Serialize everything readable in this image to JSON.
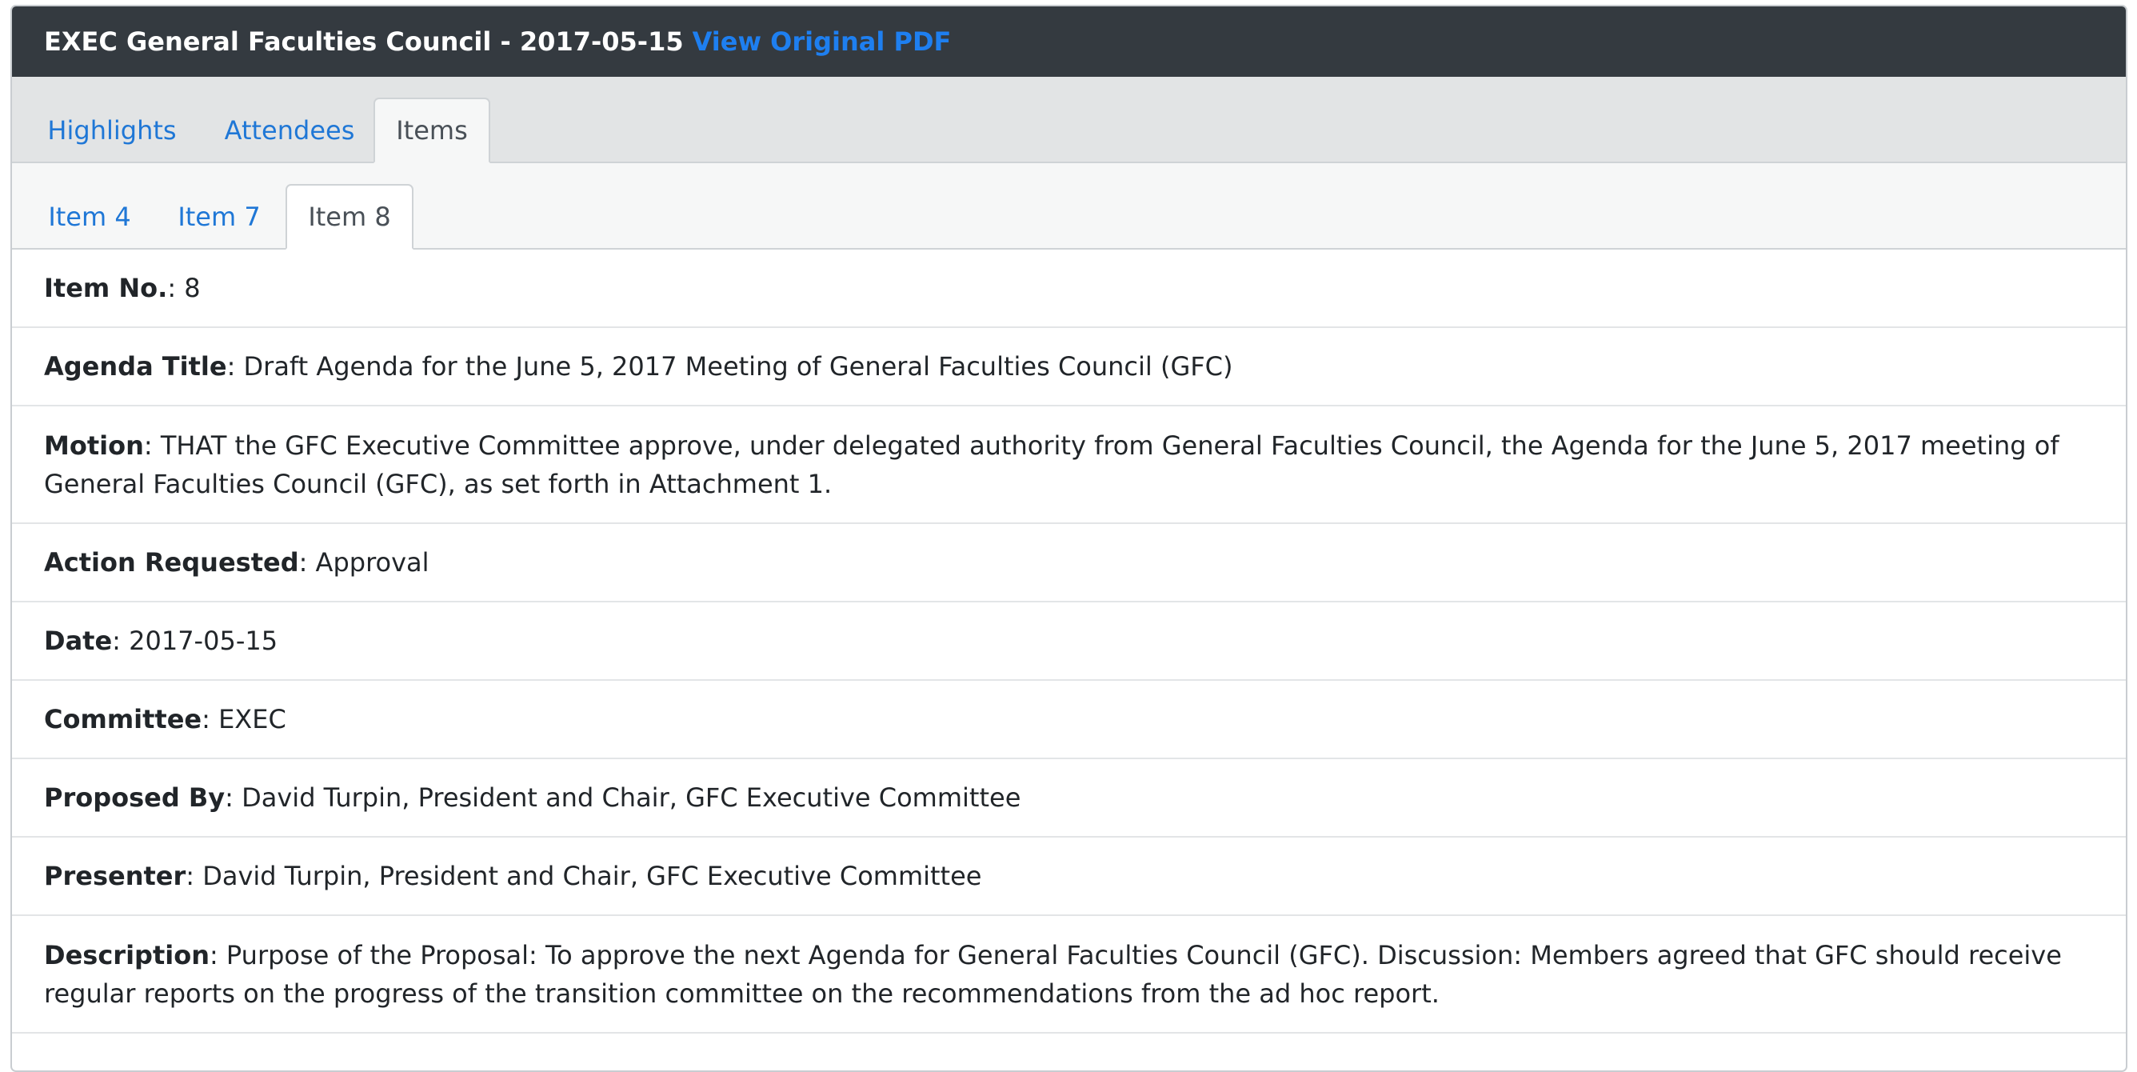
{
  "header": {
    "title": "EXEC General Faculties Council - 2017-05-15",
    "pdf_link": "View Original PDF"
  },
  "main_tabs": [
    {
      "label": "Highlights"
    },
    {
      "label": "Attendees"
    },
    {
      "label": "Items"
    }
  ],
  "item_tabs": [
    {
      "label": "Item 4"
    },
    {
      "label": "Item 7"
    },
    {
      "label": "Item 8"
    }
  ],
  "fields": [
    {
      "label": "Item No.",
      "value": ": 8"
    },
    {
      "label": "Agenda Title",
      "value": ": Draft Agenda for the June 5, 2017 Meeting of General Faculties Council (GFC)"
    },
    {
      "label": "Motion",
      "value": ": THAT the GFC Executive Committee approve, under delegated authority from General Faculties Council, the Agenda for the June 5, 2017 meeting of General Faculties Council (GFC), as set forth in Attachment 1."
    },
    {
      "label": "Action Requested",
      "value": ": Approval"
    },
    {
      "label": "Date",
      "value": ": 2017-05-15"
    },
    {
      "label": "Committee",
      "value": ": EXEC"
    },
    {
      "label": "Proposed By",
      "value": ": David Turpin, President and Chair, GFC Executive Committee"
    },
    {
      "label": "Presenter",
      "value": ": David Turpin, President and Chair, GFC Executive Committee"
    },
    {
      "label": "Description",
      "value": ": Purpose of the Proposal: To approve the next Agenda for General Faculties Council (GFC). Discussion: Members agreed that GFC should receive regular reports on the progress of the transition committee on the recommendations from the ad hoc report."
    }
  ]
}
